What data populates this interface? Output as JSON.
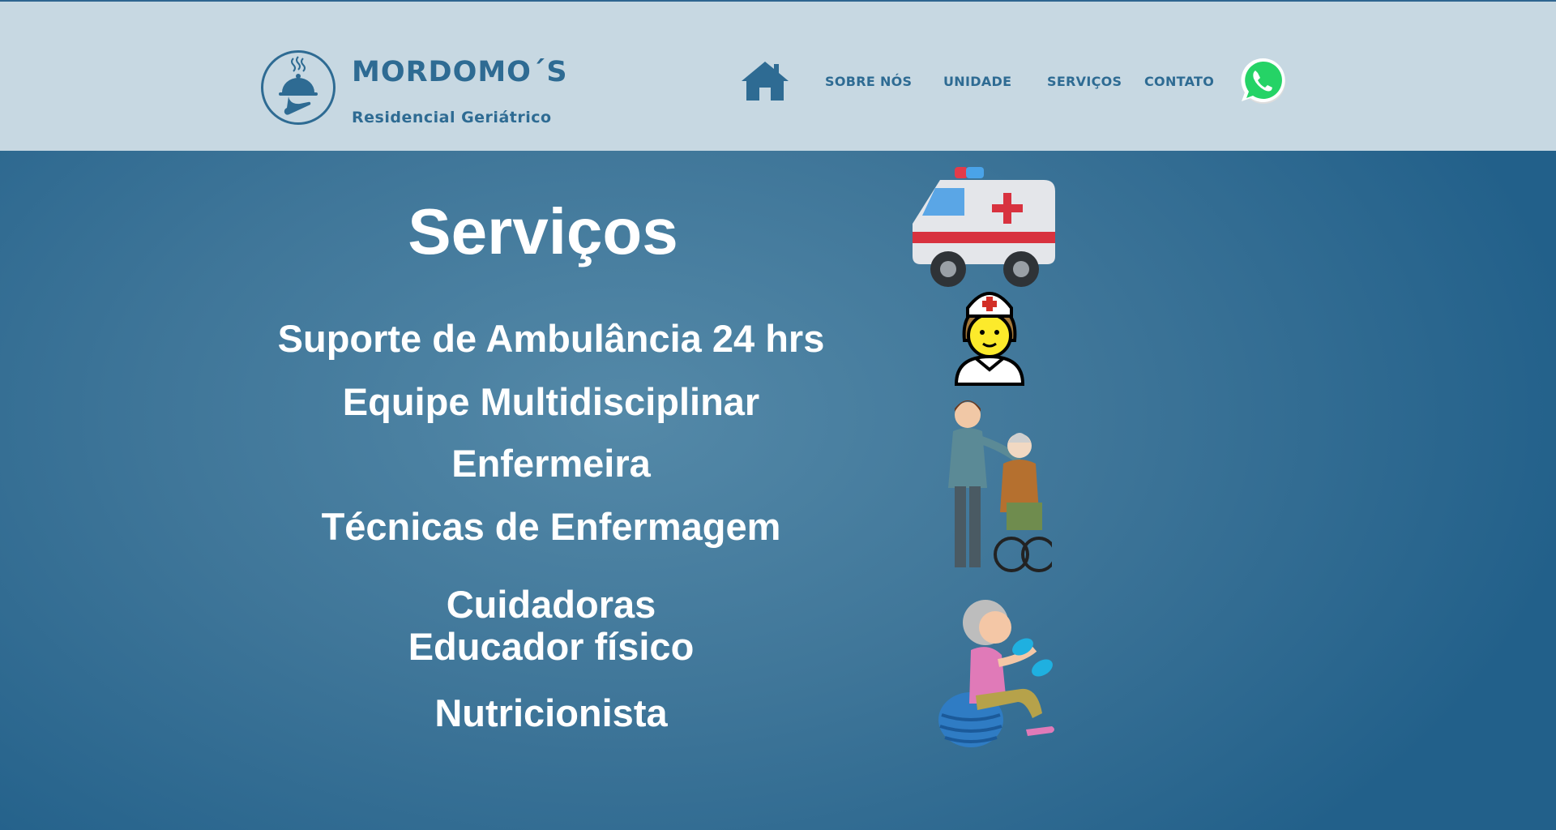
{
  "brand": {
    "name": "MORDOMO´S",
    "subtitle": "Residencial Geriátrico",
    "icon": "cloche-on-hand-icon"
  },
  "nav": {
    "home_icon": "home-icon",
    "items": [
      {
        "label": "SOBRE NÓS"
      },
      {
        "label": "UNIDADE"
      },
      {
        "label": "SERVIÇOS"
      },
      {
        "label": "CONTATO"
      }
    ],
    "whatsapp_icon": "whatsapp-icon"
  },
  "main": {
    "title": "Serviços",
    "services": [
      "Suporte de Ambulância 24 hrs",
      "Equipe Multidisciplinar",
      "Enfermeira",
      "Técnicas de Enfermagem",
      "Cuidadoras",
      "Educador físico",
      "Nutricionista"
    ],
    "illustrations": [
      "ambulance-icon",
      "nurse-icon",
      "caregiver-with-elderly-icon",
      "elderly-exercise-icon"
    ]
  },
  "colors": {
    "header_bg": "#c7d8e2",
    "brand_blue": "#2e6b93",
    "body_bg": "#3f7699",
    "whatsapp_green": "#25d366"
  }
}
